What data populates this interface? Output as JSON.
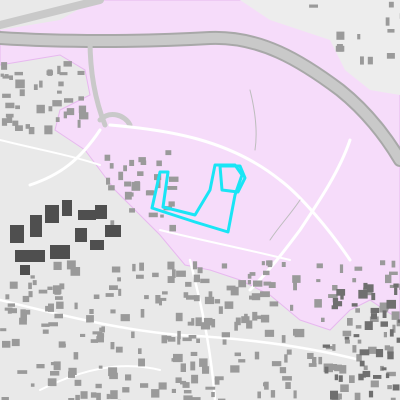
{
  "map": {
    "style": "grayscale base map with pink protected-area overlay and highlighted parcel outlines",
    "colors": {
      "background": "#e9e9e9",
      "protected_area_fill": "#f6dcfa",
      "protected_area_edge": "#e7b8ef",
      "major_road": "#c9c9c9",
      "major_road_casing": "#a8a8a8",
      "minor_road": "#ffffff",
      "building": "#9a9a9a",
      "building_dark": "#6f6f6f",
      "industrial_building": "#4f4f4f",
      "parcel_outline": "#19e5f5",
      "footpath": "#bdbdbd"
    },
    "layers": [
      {
        "id": "protected-area",
        "label": ""
      },
      {
        "id": "motorway",
        "label": ""
      },
      {
        "id": "parcels",
        "label": ""
      },
      {
        "id": "buildings",
        "label": ""
      }
    ],
    "parcel_count": 2
  }
}
